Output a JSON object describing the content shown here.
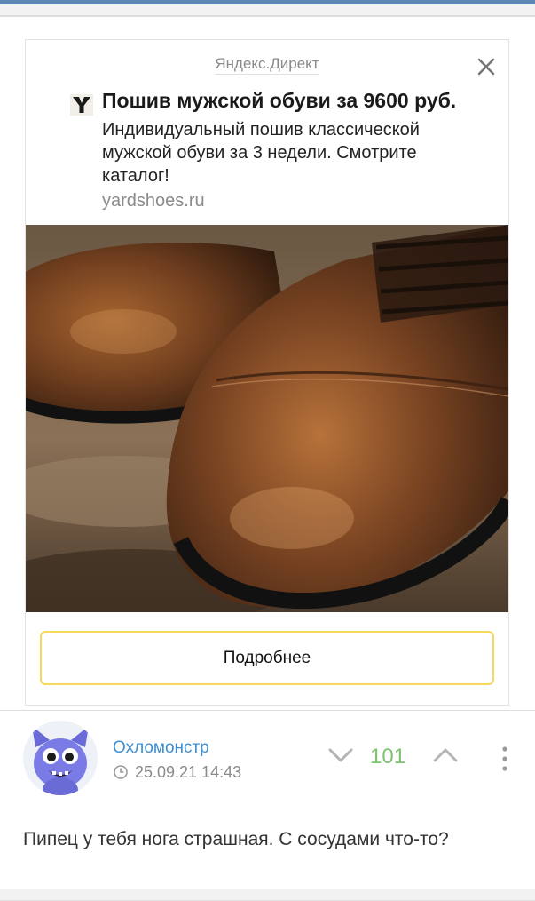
{
  "ad": {
    "source": "Яндекс.Директ",
    "title": "Пошив мужской обуви за 9600 руб.",
    "description": "Индивидуальный пошив классической мужской обуви за 3 недели. Смотрите каталог!",
    "domain": "yardshoes.ru",
    "button_label": "Подробнее",
    "image": "brown-oxford-shoes-photo",
    "logo_letter": "Y"
  },
  "comment": {
    "author": "Охломонстр",
    "timestamp": "25.09.21 14:43",
    "rating": "101",
    "text": "Пипец у тебя нога страшная. С сосудами что-то?",
    "avatar": "blue-monster-avatar"
  },
  "icons": {
    "close": "close-icon",
    "clock": "clock-icon",
    "vote_down": "chevron-down-icon",
    "vote_up": "chevron-up-icon",
    "more": "more-vertical-icon"
  },
  "colors": {
    "top_strip": "#5f87b5",
    "author": "#3e8fd3",
    "rating": "#7dc36f",
    "button_border": "#f6d85a"
  }
}
